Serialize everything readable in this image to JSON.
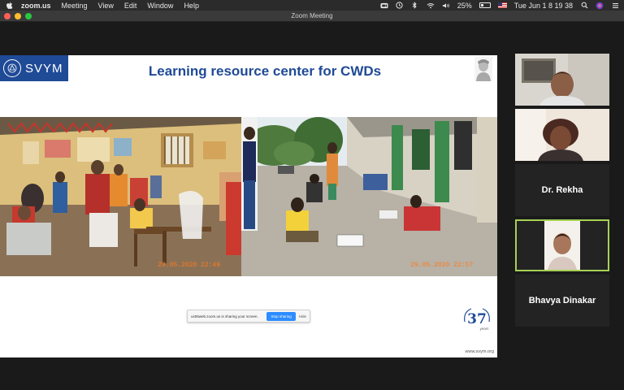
{
  "menubar": {
    "app": "zoom.us",
    "menus": [
      "Meeting",
      "View",
      "Edit",
      "Window",
      "Help"
    ],
    "battery": "25%",
    "battery_fraction": 0.25,
    "clock": "Tue Jun 1  8 19 38"
  },
  "window": {
    "title": "Zoom Meeting"
  },
  "slide": {
    "logo": "SVYM",
    "title": "Learning resource center for CWDs",
    "photo_left_timestamp": "29.05.2020 22:49",
    "photo_right_timestamp": "29.05.2020 22:5?",
    "anniversary_mark": "37",
    "anniversary_sub": "years",
    "url": "www.svym.org"
  },
  "share_bar": {
    "text": "us06web.zoom.us is sharing your screen.",
    "stop_label": "Stop sharing",
    "hide_label": "Hide"
  },
  "participants": [
    {
      "name": "",
      "video": "man"
    },
    {
      "name": "",
      "video": "woman"
    },
    {
      "name": "Dr. Rekha",
      "video": "none"
    },
    {
      "name": "",
      "video": "woman-small",
      "active": true
    },
    {
      "name": "Bhavya Dinakar",
      "video": "none"
    }
  ],
  "colors": {
    "brand_blue": "#1f4a96",
    "active_speaker": "#a6d156",
    "stop_button": "#2d8cff",
    "timestamp": "#ff7a1a"
  }
}
